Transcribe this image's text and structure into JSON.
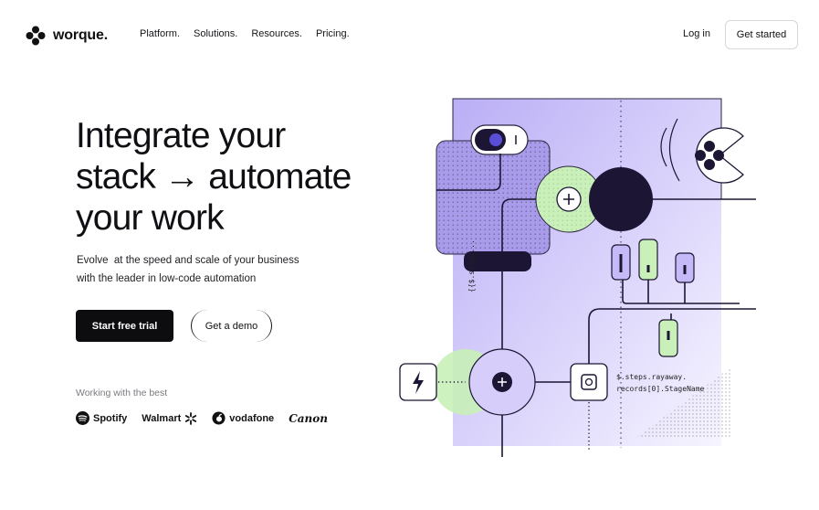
{
  "header": {
    "brand": "worque.",
    "nav": [
      "Platform.",
      "Solutions.",
      "Resources.",
      "Pricing."
    ],
    "login_label": "Log in",
    "cta_label": "Get started"
  },
  "hero": {
    "title_line1": "Integrate your",
    "title_line2": "stack → automate",
    "title_line3": "your work",
    "subtitle_line1": "Evolve  at the speed and scale of your business",
    "subtitle_line2": "with the leader in low-code automation",
    "primary_cta": "Start free trial",
    "secondary_cta": "Get a demo"
  },
  "partners": {
    "label": "Working with the best",
    "brands": [
      "Spotify",
      "Walmart",
      "vodafone",
      "Canon"
    ]
  },
  "illustration": {
    "code_vertical": "{{$.steps...",
    "code_line1": "$.steps.rayaway.",
    "code_line2": "records[0].StageName"
  },
  "colors": {
    "primary": "#0d0d10",
    "lavender": "#bdb2f7",
    "mint": "#c8f0b8",
    "navy": "#1c1533"
  },
  "icons": [
    "logo-mark-icon",
    "plus-icon",
    "lightning-icon",
    "chip-icon",
    "fan-icon",
    "spotify-icon",
    "walmart-spark-icon",
    "vodafone-icon"
  ]
}
